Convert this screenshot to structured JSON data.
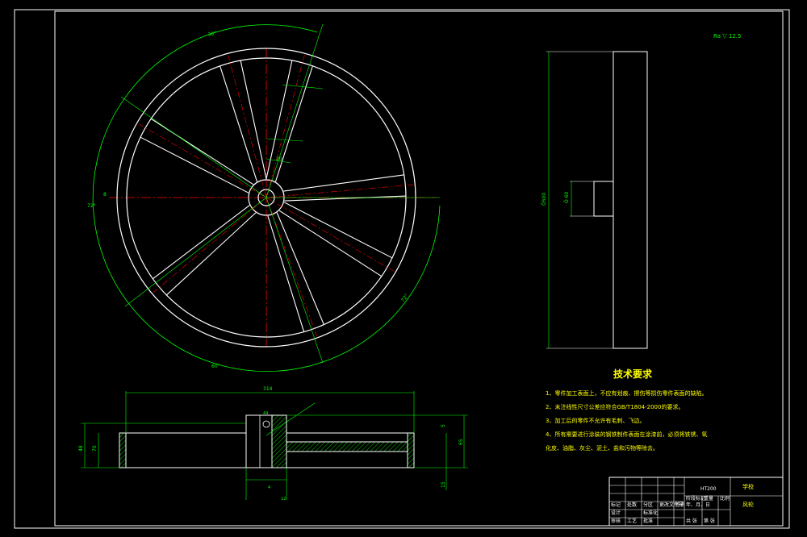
{
  "drawing": {
    "roughness_symbol": "Ra ▽ 12.5",
    "dims": {
      "angle_top": "30°",
      "angle_left": "72°",
      "angle_bottom": "60°",
      "angle_right": "72°",
      "small_left": "8",
      "hub_width": "20",
      "side_height": "Ö500",
      "side_hub": "Ö 60",
      "section_length": "314",
      "section_hub_dim": "44",
      "section_total_height": "48",
      "section_left": "70",
      "section_right_small": "5",
      "section_right_big": "65",
      "section_bottom_right": "15",
      "section_bottom_left": "12",
      "section_bottom_small": "4"
    }
  },
  "tech_requirements": {
    "title": "技术要求",
    "items": [
      "1、零件加工表面上，不应有划痕、擦伤等损伤零件表面的缺陷。",
      "2、未注线性尺寸公差应符合GB/T1804-2000的要求。",
      "3、加工后的零件不允许有毛刺、飞边。",
      "4、所有需要进行涂装的钢铁制件表面在涂漆前，必须将铁锈、氧",
      "化皮、油脂、灰尘、泥土、盐和污物等除去。"
    ]
  },
  "title_block": {
    "material": "HT200",
    "school": "学校",
    "part_name": "风轮",
    "cells": [
      "标记",
      "处数",
      "分区",
      "更改文件号",
      "签名",
      "年、月、日",
      "设计",
      "标准化",
      "阶段标记",
      "重量",
      "比例",
      "审核",
      "工艺",
      "批准",
      "共 张",
      "第 张"
    ]
  }
}
